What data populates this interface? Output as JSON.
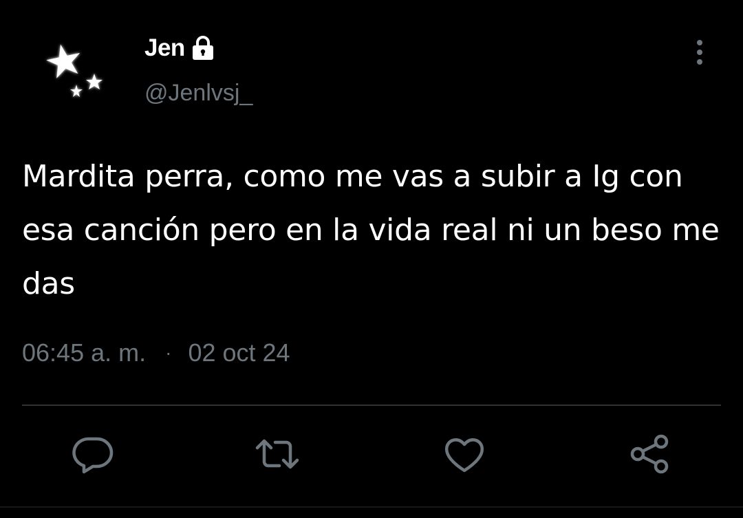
{
  "user": {
    "display_name": "Jen",
    "handle": "@Jenlvsj_",
    "protected_icon": "lock-icon",
    "avatar_icon": "stars-avatar-icon"
  },
  "tweet": {
    "text": "Mardita perra, como me vas a subir a Ig con esa canción pero en la vida real ni un beso me das",
    "time": "06:45 a. m.",
    "separator": "·",
    "date": "02 oct 24"
  },
  "actions": [
    {
      "name": "reply",
      "icon": "comment-icon"
    },
    {
      "name": "retweet",
      "icon": "retweet-icon"
    },
    {
      "name": "like",
      "icon": "heart-icon"
    },
    {
      "name": "share",
      "icon": "share-icon"
    }
  ],
  "menu": {
    "icon": "more-vertical-icon"
  },
  "colors": {
    "background": "#000000",
    "primary_text": "#ffffff",
    "secondary_text": "#6e767d",
    "divider": "#2f3336"
  }
}
